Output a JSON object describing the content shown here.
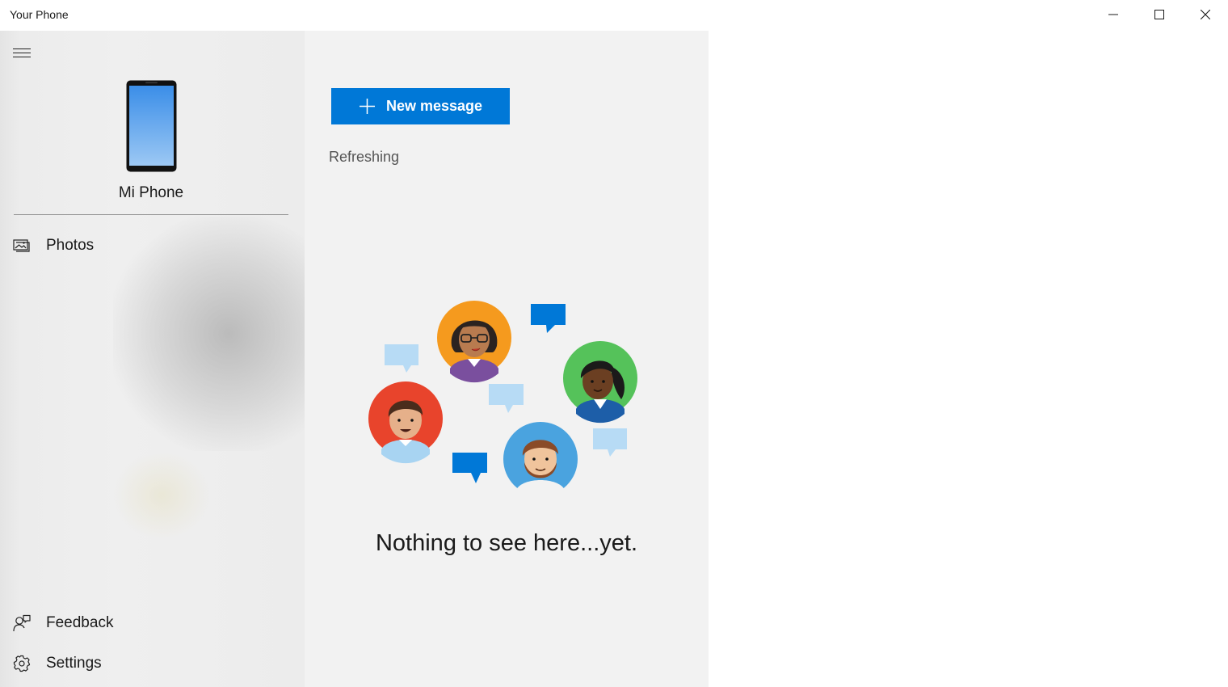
{
  "window": {
    "title": "Your Phone",
    "controls": [
      "minimize-icon",
      "maximize-icon",
      "close-icon"
    ]
  },
  "sidebar": {
    "menu_icon": "hamburger-icon",
    "device": {
      "name": "Mi Phone",
      "icon": "phone-icon"
    },
    "nav_items": [
      {
        "label": "Photos",
        "icon": "photos-icon"
      }
    ],
    "footer_items": [
      {
        "label": "Feedback",
        "icon": "feedback-icon"
      },
      {
        "label": "Settings",
        "icon": "gear-icon"
      }
    ]
  },
  "main": {
    "new_message_label": "New message",
    "status_text": "Refreshing",
    "empty_state_text": "Nothing to see here...yet."
  },
  "colors": {
    "accent": "#0078d7",
    "main_background": "#f2f2f2",
    "sidebar_background": "#ececec",
    "bubble_dark": "#0078d7",
    "bubble_light": "#b7dbf5"
  }
}
